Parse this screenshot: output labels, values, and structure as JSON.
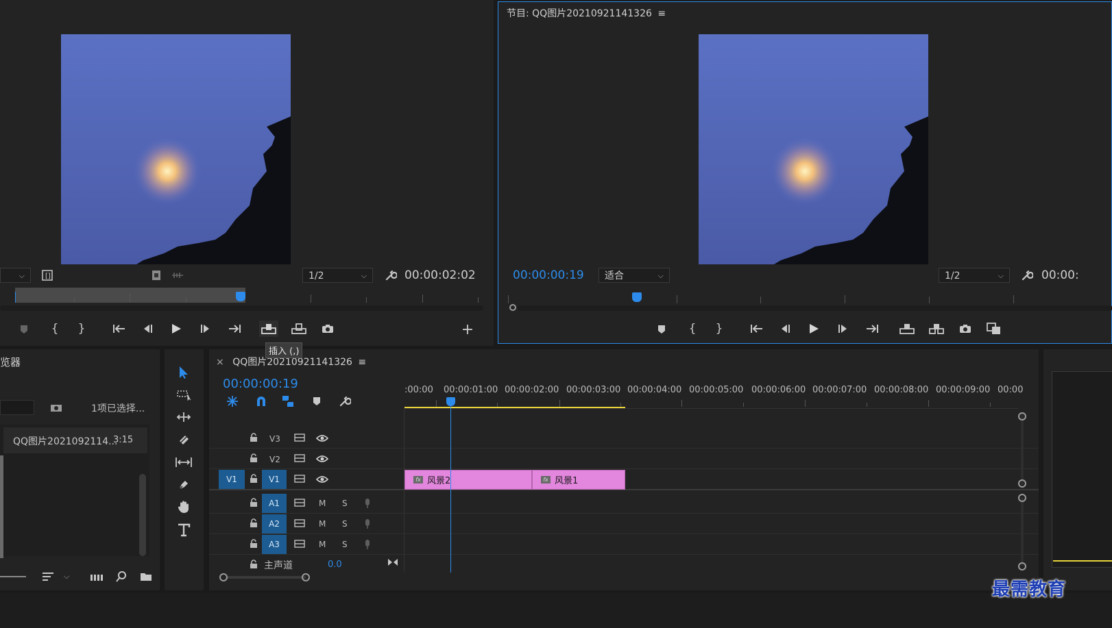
{
  "source_monitor": {
    "zoom": "1/2",
    "timecode": "00:00:02:02",
    "tooltip": "插入 (,)"
  },
  "program_monitor": {
    "title": "节目: QQ图片20210921141326",
    "menu_glyph": "≡",
    "current_timecode": "00:00:00:19",
    "fit": "适合",
    "zoom": "1/2",
    "duration_timecode": "00:00:"
  },
  "project_panel": {
    "title_fragment": "览器",
    "selection_status": "1项已选择...",
    "item_name": "QQ图片2021092114...",
    "item_duration": "3:15"
  },
  "timeline": {
    "tab_close": "×",
    "sequence_name": "QQ图片20210921141326",
    "menu_glyph": "≡",
    "timecode": "00:00:00:19",
    "ruler_labels": [
      ":00:00",
      "00:00:01:00",
      "00:00:02:00",
      "00:00:03:00",
      "00:00:04:00",
      "00:00:05:00",
      "00:00:06:00",
      "00:00:07:00",
      "00:00:08:00",
      "00:00:09:00",
      "00:00"
    ],
    "video_tracks": [
      "V3",
      "V2",
      "V1"
    ],
    "source_patch": "V1",
    "audio_tracks": [
      "A1",
      "A2",
      "A3"
    ],
    "mute_label": "M",
    "solo_label": "S",
    "master_label": "主声道",
    "master_value": "0.0",
    "clips": [
      {
        "name": "风景2",
        "fx": "fx"
      },
      {
        "name": "风景1",
        "fx": "fx"
      }
    ]
  },
  "watermark": "最需教育",
  "colors": {
    "accent_blue": "#2d8ceb",
    "clip_pink": "#e386dd",
    "track_blue": "#1d5c93",
    "work_area_yellow": "#e8d43a"
  }
}
